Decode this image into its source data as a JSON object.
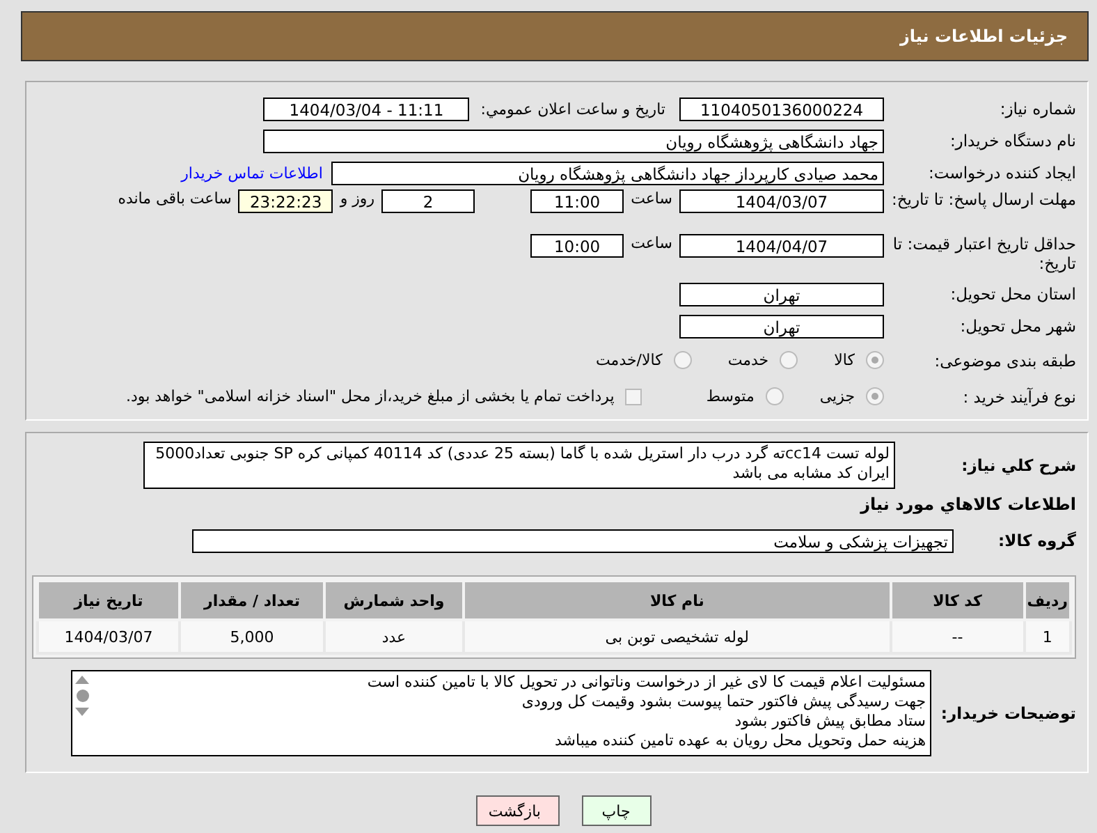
{
  "header": {
    "title": "جزئیات اطلاعات نیاز"
  },
  "need_number": {
    "label": "شماره نیاز:",
    "value": "1104050136000224"
  },
  "announce": {
    "label": "تاریخ و ساعت اعلان عمومي:",
    "value": "1404/03/04 - 11:11"
  },
  "buyer": {
    "label": "نام دستگاه خریدار:",
    "value": "جهاد دانشگاهی پژوهشگاه رویان"
  },
  "requester": {
    "label": "ایجاد کننده درخواست:",
    "value": "محمد صیادی کارپرداز جهاد دانشگاهی پژوهشگاه رویان",
    "link": "اطلاعات تماس خریدار"
  },
  "deadline": {
    "label": "مهلت ارسال پاسخ: تا تاریخ:",
    "date": "1404/03/07",
    "time_label": "ساعت",
    "time": "11:00",
    "days": "2",
    "days_label": "روز و",
    "remaining": "23:22:23",
    "remaining_label": "ساعت باقی مانده"
  },
  "validity": {
    "label": "حداقل تاریخ اعتبار قیمت: تا تاریخ:",
    "date": "1404/04/07",
    "time_label": "ساعت",
    "time": "10:00"
  },
  "province": {
    "label": "استان محل تحویل:",
    "value": "تهران"
  },
  "city": {
    "label": "شهر محل تحویل:",
    "value": "تهران"
  },
  "category": {
    "label": "طبقه بندی موضوعی:",
    "options": [
      {
        "label": "کالا",
        "selected": true
      },
      {
        "label": "خدمت",
        "selected": false
      },
      {
        "label": "کالا/خدمت",
        "selected": false
      }
    ]
  },
  "process": {
    "label": "نوع فرآیند خرید :",
    "options": [
      {
        "label": "جزیی",
        "selected": true
      },
      {
        "label": "متوسط",
        "selected": false
      }
    ],
    "payment": {
      "label": "پرداخت تمام یا بخشی از مبلغ خرید،از محل \"اسناد خزانه اسلامی\" خواهد بود.",
      "checked": false
    }
  },
  "description": {
    "label": "شرح کلي نياز:",
    "text": "لوله تست cc14ته گرد درب دار استریل شده با گاما (بسته 25 عددی) کد 40114 کمپانی کره SP جنوبی تعداد5000  ایران کد مشابه می باشد"
  },
  "goods_title": "اطلاعات كالاهاي مورد نياز",
  "goods_group": {
    "label": "گروه کالا:",
    "value": "تجهیزات پزشکی و سلامت"
  },
  "table": {
    "columns": [
      "ردیف",
      "کد کالا",
      "نام کالا",
      "واحد شمارش",
      "تعداد / مقدار",
      "تاریخ نیاز"
    ],
    "rows": [
      [
        "1",
        "--",
        "لوله تشخیصی توبن بی",
        "عدد",
        "5,000",
        "1404/03/07"
      ]
    ]
  },
  "notes": {
    "label": "توضیحات خریدار:",
    "lines": [
      "مسئولیت اعلام قیمت کا لای  غیر از درخواست وناتوانی در تحویل کالا با تامین کننده است",
      "جهت رسیدگی پیش فاکتور حتما پیوست بشود وقیمت کل ورودی",
      "ستاد مطابق پیش فاکتور بشود",
      "هزینه حمل وتحویل محل رویان به عهده تامین کننده میباشد"
    ]
  },
  "buttons": [
    {
      "label": "چاپ",
      "kind": "print"
    },
    {
      "label": "بازگشت",
      "kind": "back"
    }
  ]
}
